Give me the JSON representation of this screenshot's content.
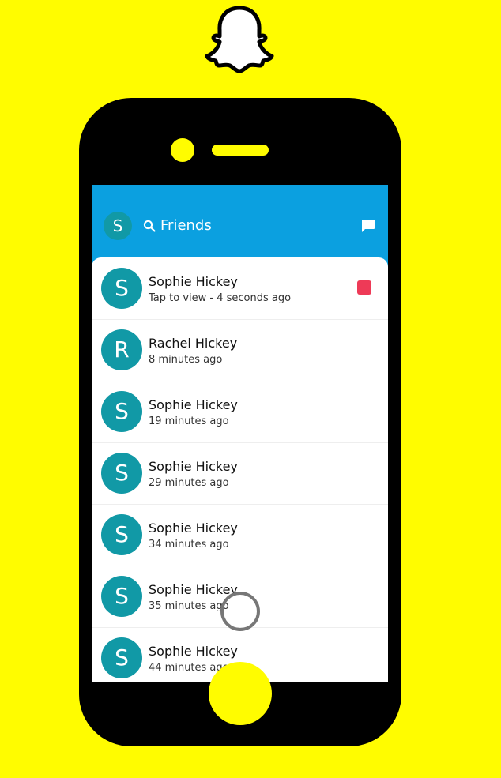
{
  "header": {
    "avatar_initial": "S",
    "title": "Friends",
    "search_icon": "search-icon",
    "chat_icon": "chat-icon"
  },
  "brand": {
    "logo": "snapchat-ghost-logo",
    "accent": "#fffc00",
    "header_bg": "#0ba0e0",
    "avatar_bg": "#1199a6",
    "unread_badge": "#ee3a57"
  },
  "friends": [
    {
      "initial": "S",
      "name": "Sophie Hickey",
      "status": "Tap to view - 4 seconds ago",
      "unread": true
    },
    {
      "initial": "R",
      "name": "Rachel Hickey",
      "status": "8 minutes ago",
      "unread": false
    },
    {
      "initial": "S",
      "name": "Sophie Hickey",
      "status": "19 minutes ago",
      "unread": false
    },
    {
      "initial": "S",
      "name": "Sophie Hickey",
      "status": "29 minutes ago",
      "unread": false
    },
    {
      "initial": "S",
      "name": "Sophie Hickey",
      "status": "34 minutes ago",
      "unread": false
    },
    {
      "initial": "S",
      "name": "Sophie Hickey",
      "status": "35 minutes ago",
      "unread": false
    },
    {
      "initial": "S",
      "name": "Sophie Hickey",
      "status": "44 minutes ago",
      "unread": false
    }
  ]
}
